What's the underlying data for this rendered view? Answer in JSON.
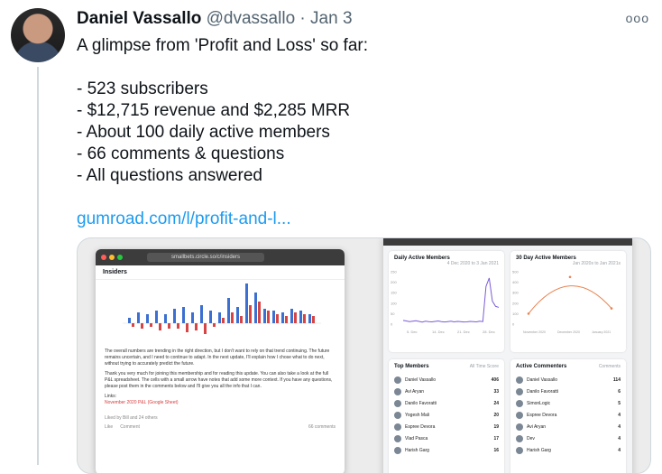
{
  "tweet": {
    "author_name": "Daniel Vassallo",
    "handle": "@dvassallo",
    "separator": "·",
    "date": "Jan 3",
    "more_icon": "ooo",
    "body": "A glimpse from 'Profit and Loss' so far:\n\n- 523 subscribers\n- $12,715 revenue and $2,285 MRR\n- About 100 daily active members\n- 66 comments & questions\n- All questions answered",
    "link": "gumroad.com/l/profit-and-l..."
  },
  "media": {
    "left": {
      "url": "smallbets.circle.so/c/insiders",
      "title": "Insiders",
      "para1": "The overall numbers are trending in the right direction, but I don't want to rely on that trend continuing. The future remains uncertain, and I need to continue to adapt. In the next update, I'll explain how I chose what to do next, without trying to accurately predict the future.",
      "para2": "Thank you very much for joining this membership and for reading this update. You can also take a look at the full P&L spreadsheet. The cells with a small arrow have notes that add some more context. If you have any questions, please post them in the comments below and I'll give you all the info that I can.",
      "links_label": "Links:",
      "link_item": "November 2020 P&L (Google Sheet)",
      "liked_by": "Liked by Bill and 24 others",
      "like": "Like",
      "comment": "Comment",
      "comments_count": "66 comments",
      "bar_values_blue": [
        3,
        6,
        5,
        7,
        5,
        8,
        9,
        6,
        10,
        7,
        6,
        14,
        9,
        22,
        17,
        8,
        7,
        6,
        8,
        7,
        5
      ],
      "bar_values_red": [
        -2,
        -3,
        -2,
        -4,
        -3,
        -3,
        -5,
        -4,
        -6,
        -2,
        3,
        6,
        4,
        10,
        12,
        7,
        5,
        4,
        6,
        5,
        4
      ]
    },
    "right": {
      "dau_title": "Daily Active Members",
      "dau_range": "4 Dec 2020 to 3 Jan 2021",
      "dau_x_labels": [
        "5. Dec",
        "14. Dec",
        "21. Dec",
        "28. Dec"
      ],
      "dau_y_labels": [
        "250",
        "200",
        "150",
        "100",
        "50",
        "0"
      ],
      "dau_values": [
        18,
        15,
        12,
        14,
        16,
        13,
        10,
        14,
        12,
        11,
        13,
        15,
        12,
        10,
        12,
        14,
        11,
        13,
        12,
        10,
        11,
        13,
        12,
        11,
        14,
        12,
        180,
        220,
        110,
        85,
        80
      ],
      "active30_title": "30 Day Active Members",
      "active30_range": "Jan 2020s to Jan 2021s",
      "active30_x_labels": [
        "November 2020",
        "December 2020",
        "January 2021"
      ],
      "active30_y_labels": [
        "500",
        "400",
        "300",
        "200",
        "100",
        "0"
      ],
      "active30_values": [
        100,
        450,
        150
      ],
      "top_members_title": "Top Members",
      "top_members_filter": "All Time Score",
      "top_members": [
        {
          "name": "Daniel Vassallo",
          "score": "406"
        },
        {
          "name": "Avi Aryan",
          "score": "33"
        },
        {
          "name": "Danilo Favoratti",
          "score": "24"
        },
        {
          "name": "Yogesh Mali",
          "score": "20"
        },
        {
          "name": "Espree Devora",
          "score": "19"
        },
        {
          "name": "Vlad Pasca",
          "score": "17"
        },
        {
          "name": "Harish Garg",
          "score": "16"
        }
      ],
      "commenters_title": "Active Commenters",
      "commenters_filter": "Comments",
      "commenters": [
        {
          "name": "Daniel Vassallo",
          "count": "114"
        },
        {
          "name": "Danilo Favoratti",
          "count": "6"
        },
        {
          "name": "SimonLogic",
          "count": "5"
        },
        {
          "name": "Espree Devora",
          "count": "4"
        },
        {
          "name": "Avi Aryan",
          "count": "4"
        },
        {
          "name": "Dev",
          "count": "4"
        },
        {
          "name": "Harish Garg",
          "count": "4"
        }
      ]
    }
  }
}
